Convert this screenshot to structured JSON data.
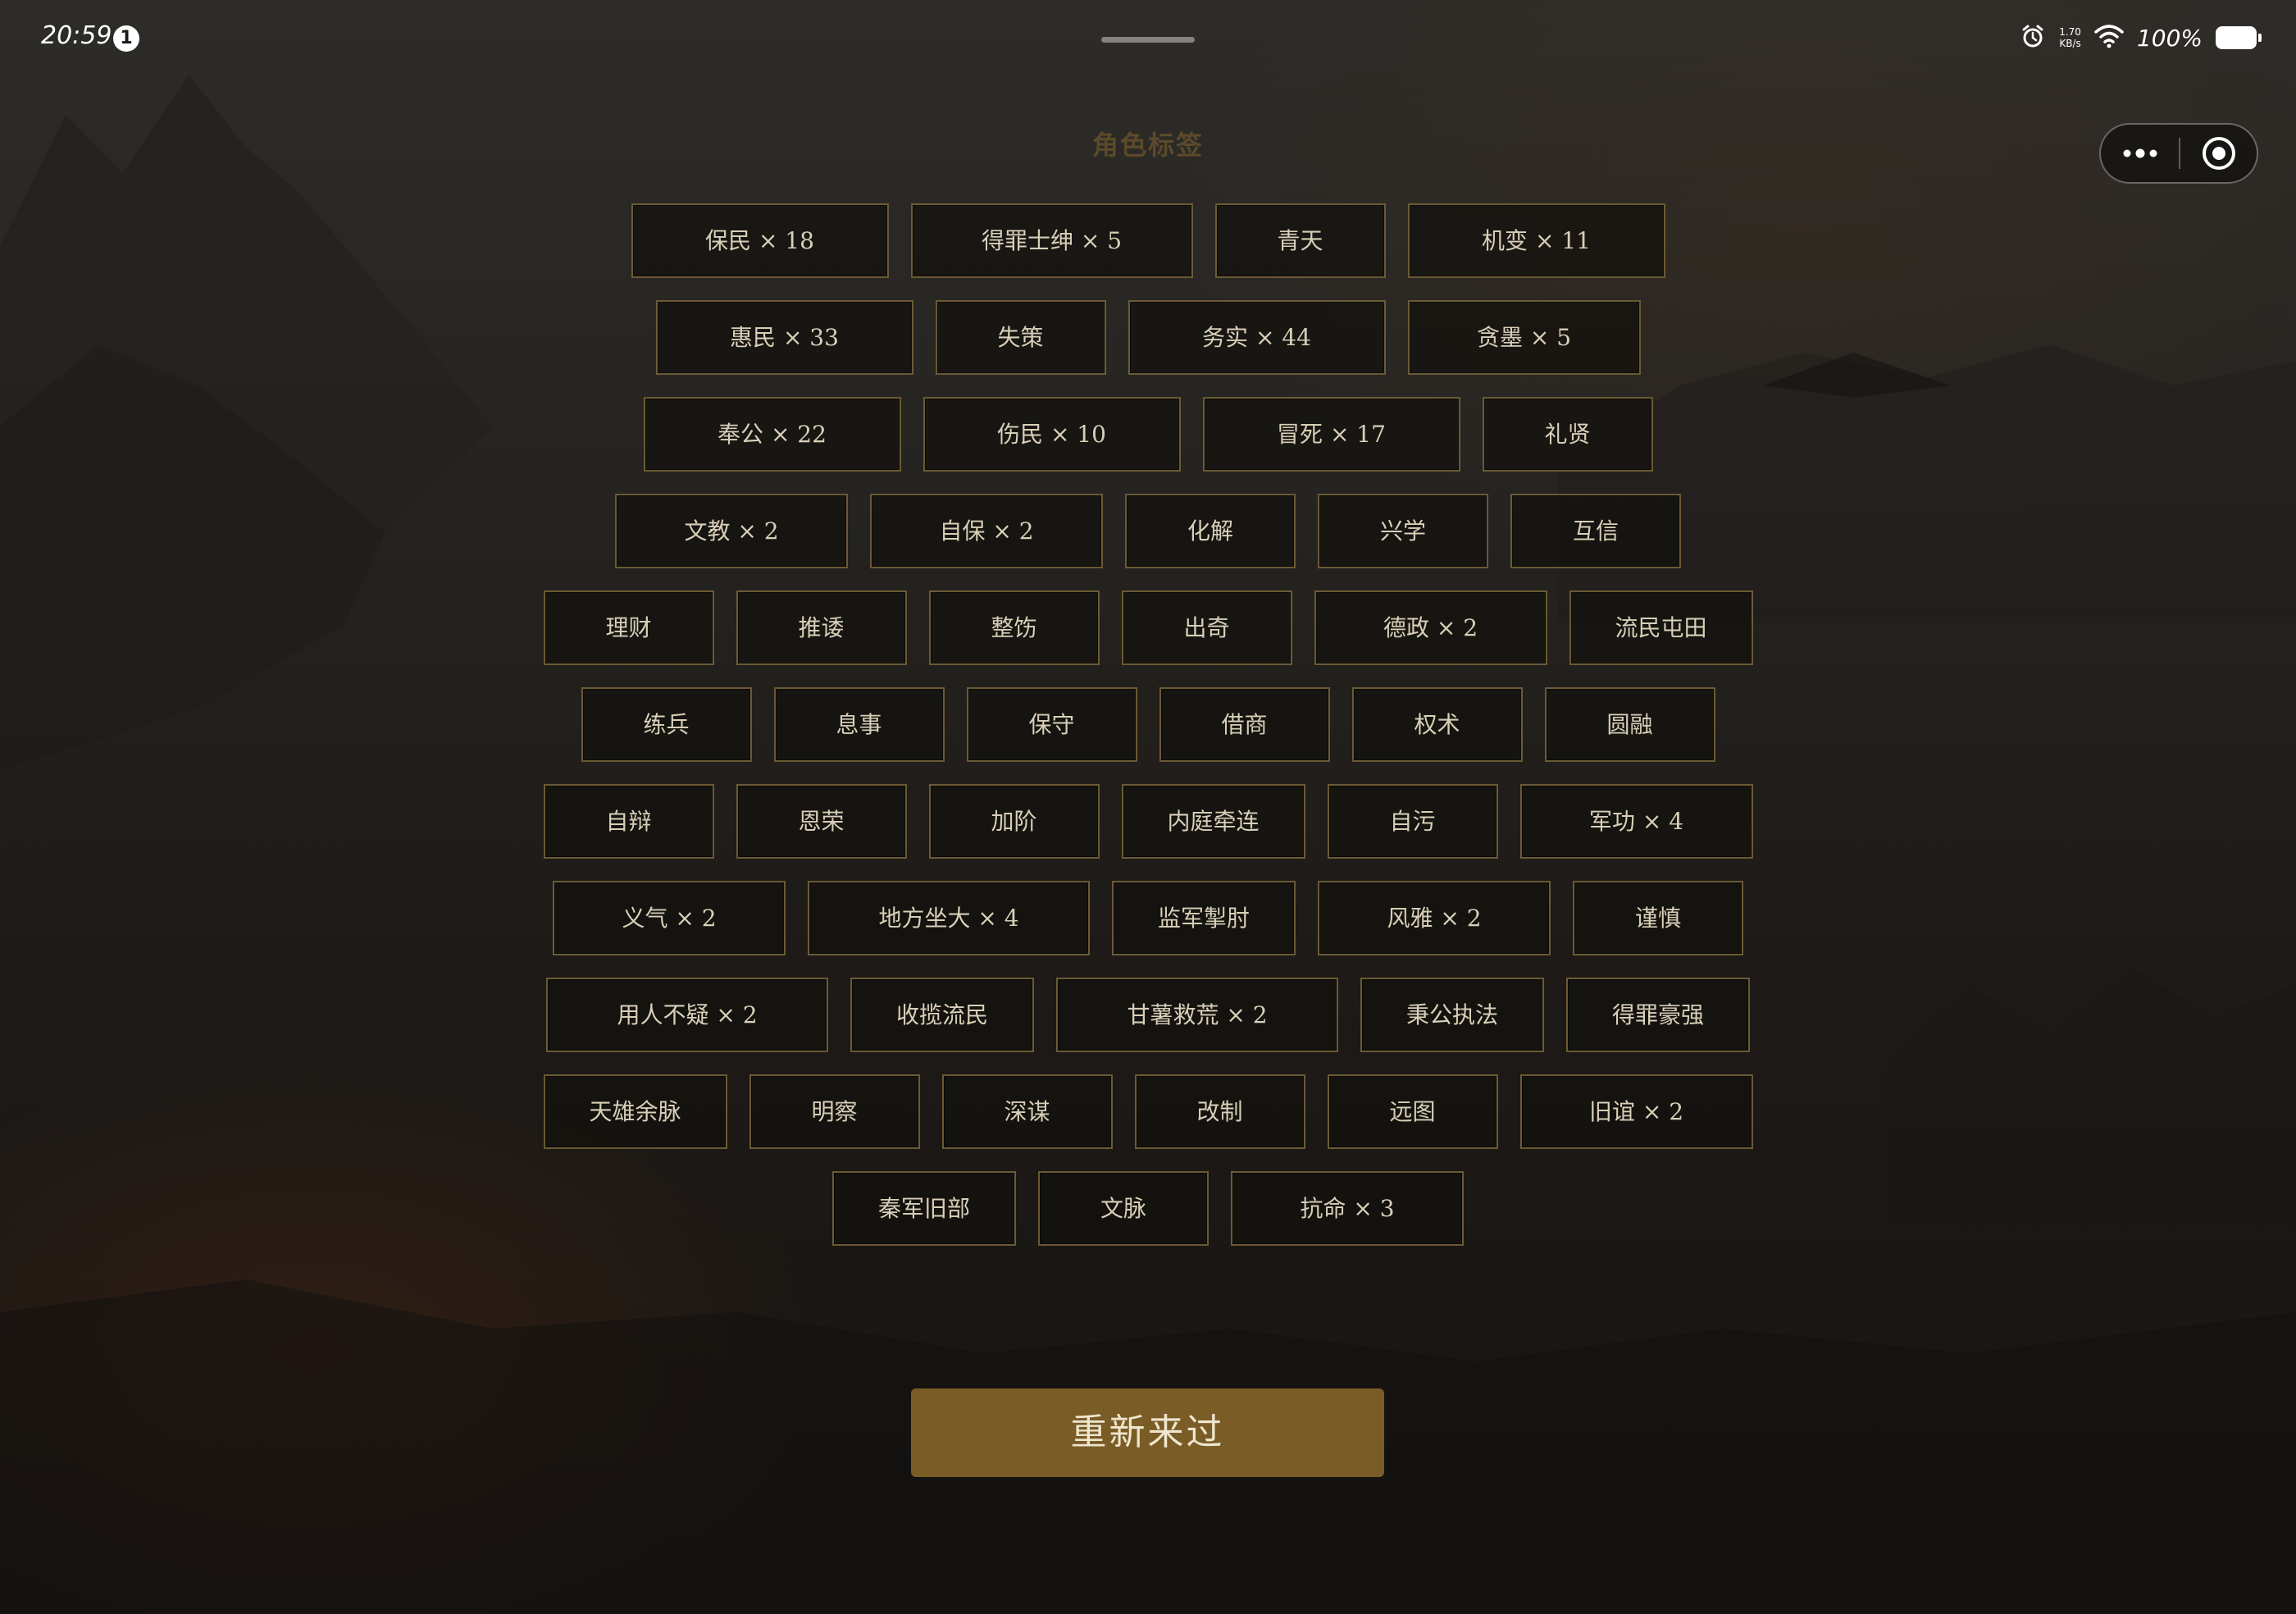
{
  "status_bar": {
    "time": "20:59",
    "notification_count": "1",
    "net_speed_value": "1.70",
    "net_speed_unit": "KB/s",
    "battery": "100%",
    "icons": [
      "alarm-icon",
      "wifi-icon",
      "battery-icon"
    ]
  },
  "capsule": {
    "icons": [
      "more-icon",
      "close-target-icon"
    ]
  },
  "title": "角色标签",
  "tag_rows": [
    [
      "保民 × 18",
      "得罪士绅 × 5",
      "青天",
      "机变 × 11"
    ],
    [
      "惠民 × 33",
      "失策",
      "务实 × 44",
      "贪墨 × 5"
    ],
    [
      "奉公 × 22",
      "伤民 × 10",
      "冒死 × 17",
      "礼贤"
    ],
    [
      "文教 × 2",
      "自保 × 2",
      "化解",
      "兴学",
      "互信"
    ],
    [
      "理财",
      "推诿",
      "整饬",
      "出奇",
      "德政 × 2",
      "流民屯田"
    ],
    [
      "练兵",
      "息事",
      "保守",
      "借商",
      "权术",
      "圆融"
    ],
    [
      "自辩",
      "恩荣",
      "加阶",
      "内庭牵连",
      "自污",
      "军功 × 4"
    ],
    [
      "义气 × 2",
      "地方坐大 × 4",
      "监军掣肘",
      "风雅 × 2",
      "谨慎"
    ],
    [
      "用人不疑 × 2",
      "收揽流民",
      "甘薯救荒 × 2",
      "秉公执法",
      "得罪豪强"
    ],
    [
      "天雄余脉",
      "明察",
      "深谋",
      "改制",
      "远图",
      "旧谊 × 2"
    ],
    [
      "秦军旧部",
      "文脉",
      "抗命 × 3"
    ]
  ],
  "restart_label": "重新来过",
  "colors": {
    "tag_border": "#6b5a35",
    "title": "#5b4a2a",
    "button": "#7a5c26"
  }
}
